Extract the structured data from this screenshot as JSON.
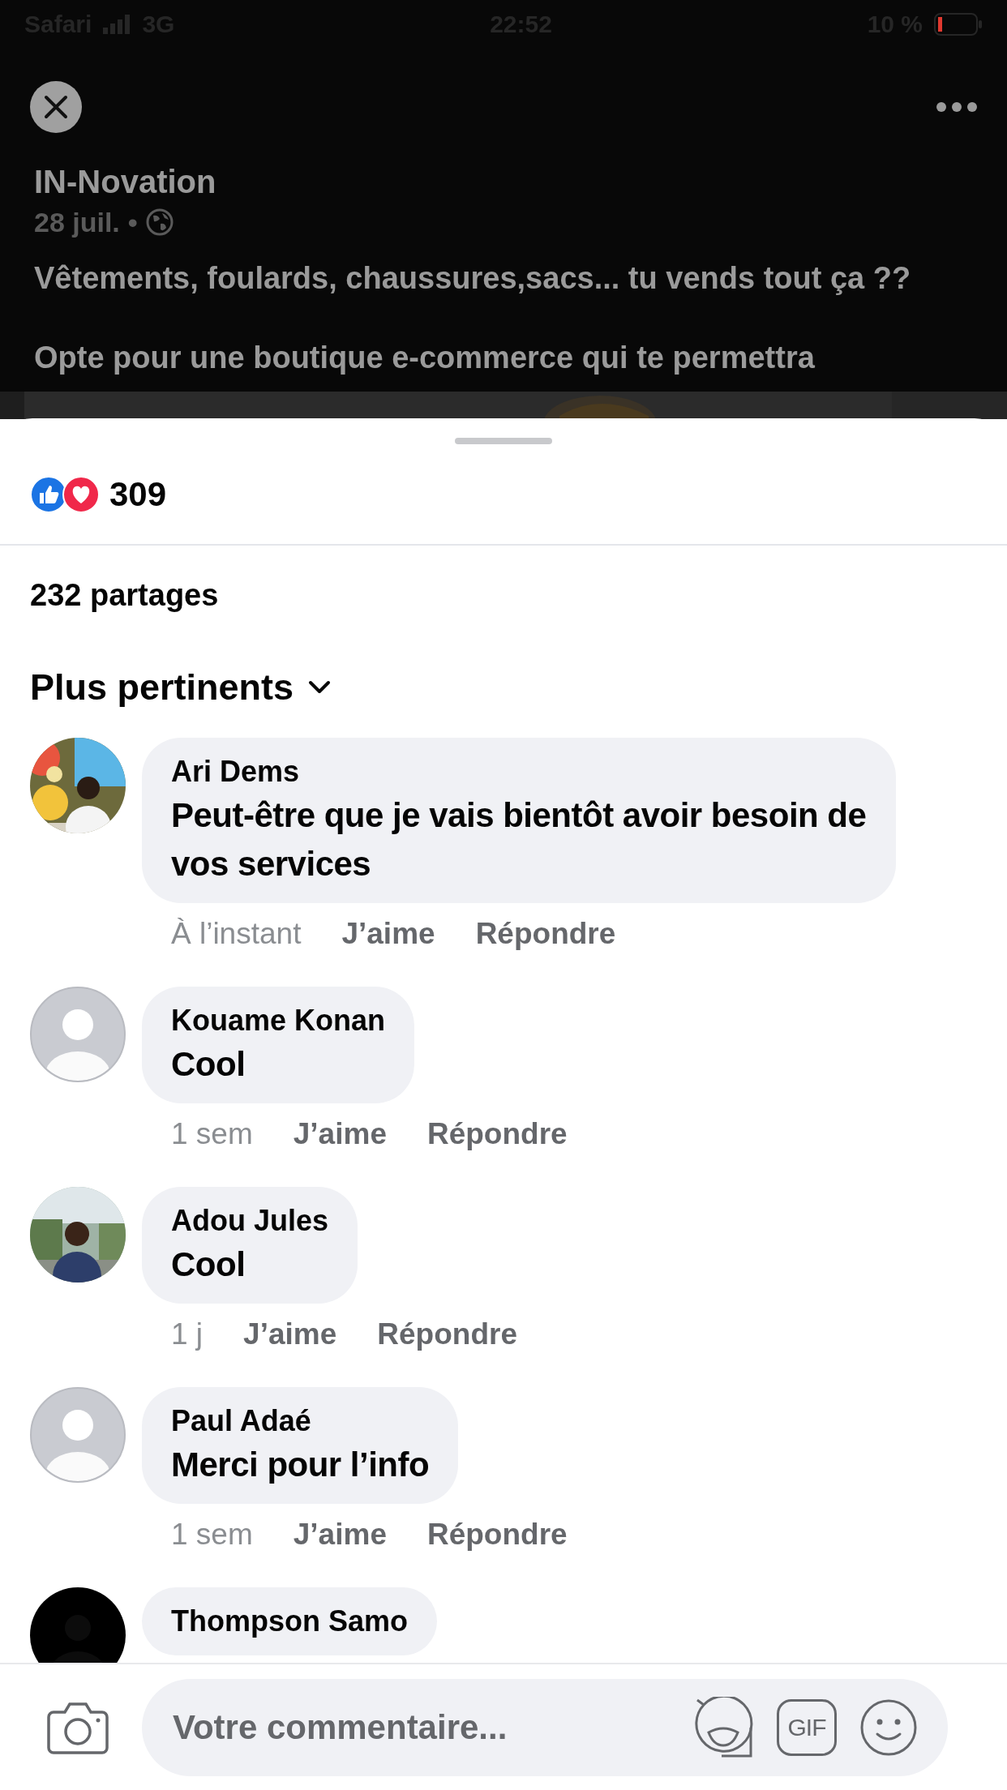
{
  "status_bar": {
    "back_app": "Safari",
    "network": "3G",
    "time": "22:52",
    "battery": "10 %"
  },
  "post": {
    "author": "IN-Novation",
    "date": "28 juil.",
    "separator": "•",
    "paragraphs": [
      "Vêtements, foulards, chaussures,sacs... tu vends tout ça ??",
      "Opte pour une boutique e-commerce qui te permettra"
    ]
  },
  "reactions": {
    "count": "309"
  },
  "shares": "232 partages",
  "sort": {
    "label": "Plus pertinents"
  },
  "comments": [
    {
      "name": "Ari Dems",
      "text": "Peut-être que je vais bientôt avoir besoin de vos services",
      "time": "À l’instant",
      "like": "J’aime",
      "reply": "Répondre"
    },
    {
      "avatar": {
        "kind": "placeholder"
      },
      "name": "Kouame Konan",
      "text": "Cool",
      "time": "1 sem",
      "like": "J’aime",
      "reply": "Répondre"
    },
    {
      "name": "Adou Jules",
      "text": "Cool",
      "time": "1 j",
      "like": "J’aime",
      "reply": "Répondre"
    },
    {
      "avatar": {
        "kind": "placeholder"
      },
      "name": "Paul Adaé",
      "text": "Merci pour l’info",
      "time": "1 sem",
      "like": "J’aime",
      "reply": "Répondre"
    },
    {
      "name": "Thompson Samo"
    }
  ],
  "composer": {
    "placeholder": "Votre commentaire...",
    "gif": "GIF"
  }
}
